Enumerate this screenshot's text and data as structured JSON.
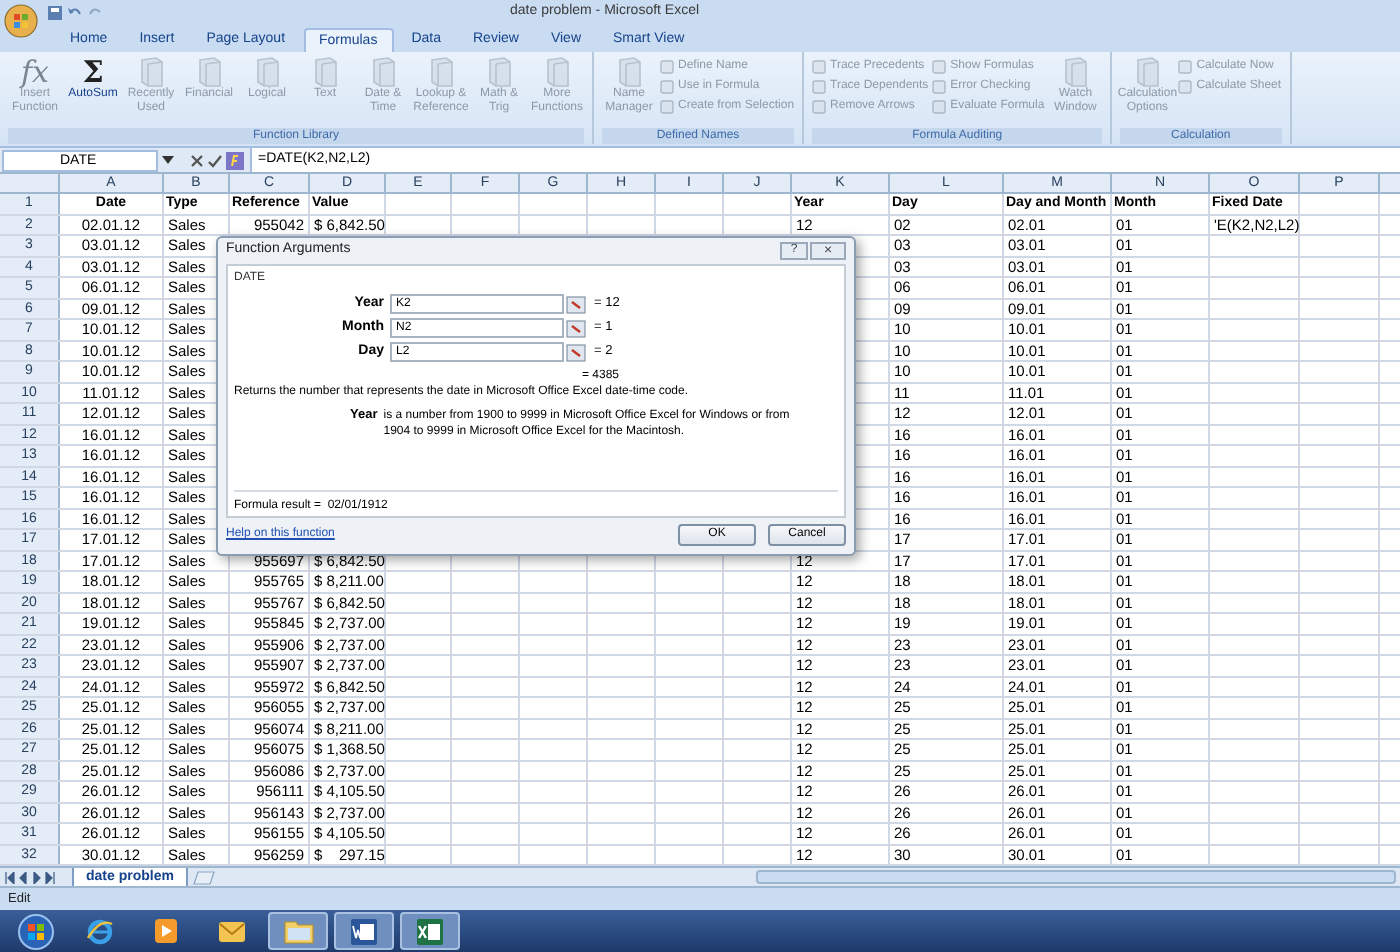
{
  "window": {
    "title": "date problem - Microsoft Excel"
  },
  "tabs": [
    {
      "label": "Home",
      "selected": false
    },
    {
      "label": "Insert",
      "selected": false
    },
    {
      "label": "Page Layout",
      "selected": false
    },
    {
      "label": "Formulas",
      "selected": true
    },
    {
      "label": "Data",
      "selected": false
    },
    {
      "label": "Review",
      "selected": false
    },
    {
      "label": "View",
      "selected": false
    },
    {
      "label": "Smart View",
      "selected": false
    }
  ],
  "ribbon": [
    {
      "label": "Function Library",
      "items": [
        {
          "kind": "large",
          "label": "Insert Function",
          "glyph": "fx",
          "disabled": true
        },
        {
          "kind": "large",
          "label": "AutoSum",
          "glyph": "Σ",
          "disabled": false
        },
        {
          "kind": "large",
          "label": "Recently Used",
          "disabled": true
        },
        {
          "kind": "large",
          "label": "Financial",
          "disabled": true
        },
        {
          "kind": "large",
          "label": "Logical",
          "disabled": true
        },
        {
          "kind": "large",
          "label": "Text",
          "disabled": true
        },
        {
          "kind": "large",
          "label": "Date & Time",
          "disabled": true
        },
        {
          "kind": "large",
          "label": "Lookup & Reference",
          "disabled": true
        },
        {
          "kind": "large",
          "label": "Math & Trig",
          "disabled": true
        },
        {
          "kind": "large",
          "label": "More Functions",
          "disabled": true
        }
      ]
    },
    {
      "label": "Defined Names",
      "items": [
        {
          "kind": "large",
          "label": "Name Manager",
          "disabled": true
        },
        {
          "kind": "small",
          "label": "Define Name",
          "disabled": true
        },
        {
          "kind": "small",
          "label": "Use in Formula",
          "disabled": true
        },
        {
          "kind": "small",
          "label": "Create from Selection",
          "disabled": true
        }
      ]
    },
    {
      "label": "Formula Auditing",
      "items": [
        {
          "kind": "small",
          "label": "Trace Precedents",
          "disabled": true
        },
        {
          "kind": "small",
          "label": "Trace Dependents",
          "disabled": true
        },
        {
          "kind": "small",
          "label": "Remove Arrows",
          "disabled": true
        },
        {
          "kind": "small",
          "label": "Show Formulas",
          "disabled": true
        },
        {
          "kind": "small",
          "label": "Error Checking",
          "disabled": true
        },
        {
          "kind": "small",
          "label": "Evaluate Formula",
          "disabled": true
        },
        {
          "kind": "large",
          "label": "Watch Window",
          "disabled": true
        }
      ]
    },
    {
      "label": "Calculation",
      "items": [
        {
          "kind": "large",
          "label": "Calculation Options",
          "disabled": true
        },
        {
          "kind": "small",
          "label": "Calculate Now",
          "disabled": true
        },
        {
          "kind": "small",
          "label": "Calculate Sheet",
          "disabled": true
        }
      ]
    }
  ],
  "formula_bar": {
    "name_box": "DATE",
    "formula": "=DATE(K2,N2,L2)"
  },
  "columns": [
    "A",
    "B",
    "C",
    "D",
    "E",
    "F",
    "G",
    "H",
    "I",
    "J",
    "K",
    "L",
    "M",
    "N",
    "O",
    "P"
  ],
  "rows": [
    {
      "number": "1",
      "cells": {
        "A": "Date",
        "B": "Type",
        "C": "Reference",
        "D": "Value",
        "K": "Year",
        "L": "Day",
        "M": "Day and Month",
        "N": "Month",
        "O": "Fixed Date"
      }
    },
    {
      "number": "2",
      "cells": {
        "A": "02.01.12",
        "B": "Sales",
        "C": "955042",
        "D": "$ 6,842.50",
        "K": "12",
        "L": "02",
        "M": "02.01",
        "N": "01",
        "O": "'E(K2,N2,L2)"
      }
    },
    {
      "number": "3",
      "cells": {
        "A": "03.01.12",
        "B": "Sales",
        "L": "03",
        "M": "03.01",
        "N": "01"
      }
    },
    {
      "number": "4",
      "cells": {
        "A": "03.01.12",
        "B": "Sales",
        "L": "03",
        "M": "03.01",
        "N": "01"
      }
    },
    {
      "number": "5",
      "cells": {
        "A": "06.01.12",
        "B": "Sales",
        "L": "06",
        "M": "06.01",
        "N": "01"
      }
    },
    {
      "number": "6",
      "cells": {
        "A": "09.01.12",
        "B": "Sales",
        "L": "09",
        "M": "09.01",
        "N": "01"
      }
    },
    {
      "number": "7",
      "cells": {
        "A": "10.01.12",
        "B": "Sales",
        "L": "10",
        "M": "10.01",
        "N": "01"
      }
    },
    {
      "number": "8",
      "cells": {
        "A": "10.01.12",
        "B": "Sales",
        "L": "10",
        "M": "10.01",
        "N": "01"
      }
    },
    {
      "number": "9",
      "cells": {
        "A": "10.01.12",
        "B": "Sales",
        "L": "10",
        "M": "10.01",
        "N": "01"
      }
    },
    {
      "number": "10",
      "cells": {
        "A": "11.01.12",
        "B": "Sales",
        "L": "11",
        "M": "11.01",
        "N": "01"
      }
    },
    {
      "number": "11",
      "cells": {
        "A": "12.01.12",
        "B": "Sales",
        "L": "12",
        "M": "12.01",
        "N": "01"
      }
    },
    {
      "number": "12",
      "cells": {
        "A": "16.01.12",
        "B": "Sales",
        "L": "16",
        "M": "16.01",
        "N": "01"
      }
    },
    {
      "number": "13",
      "cells": {
        "A": "16.01.12",
        "B": "Sales",
        "L": "16",
        "M": "16.01",
        "N": "01"
      }
    },
    {
      "number": "14",
      "cells": {
        "A": "16.01.12",
        "B": "Sales",
        "L": "16",
        "M": "16.01",
        "N": "01"
      }
    },
    {
      "number": "15",
      "cells": {
        "A": "16.01.12",
        "B": "Sales",
        "L": "16",
        "M": "16.01",
        "N": "01"
      }
    },
    {
      "number": "16",
      "cells": {
        "A": "16.01.12",
        "B": "Sales",
        "L": "16",
        "M": "16.01",
        "N": "01"
      }
    },
    {
      "number": "17",
      "cells": {
        "A": "17.01.12",
        "B": "Sales",
        "L": "17",
        "M": "17.01",
        "N": "01"
      }
    },
    {
      "number": "18",
      "cells": {
        "A": "17.01.12",
        "B": "Sales",
        "C": "955697",
        "D": "$ 6,842.50",
        "K": "12",
        "L": "17",
        "M": "17.01",
        "N": "01"
      }
    },
    {
      "number": "19",
      "cells": {
        "A": "18.01.12",
        "B": "Sales",
        "C": "955765",
        "D": "$ 8,211.00",
        "K": "12",
        "L": "18",
        "M": "18.01",
        "N": "01"
      }
    },
    {
      "number": "20",
      "cells": {
        "A": "18.01.12",
        "B": "Sales",
        "C": "955767",
        "D": "$ 6,842.50",
        "K": "12",
        "L": "18",
        "M": "18.01",
        "N": "01"
      }
    },
    {
      "number": "21",
      "cells": {
        "A": "19.01.12",
        "B": "Sales",
        "C": "955845",
        "D": "$ 2,737.00",
        "K": "12",
        "L": "19",
        "M": "19.01",
        "N": "01"
      }
    },
    {
      "number": "22",
      "cells": {
        "A": "23.01.12",
        "B": "Sales",
        "C": "955906",
        "D": "$ 2,737.00",
        "K": "12",
        "L": "23",
        "M": "23.01",
        "N": "01"
      }
    },
    {
      "number": "23",
      "cells": {
        "A": "23.01.12",
        "B": "Sales",
        "C": "955907",
        "D": "$ 2,737.00",
        "K": "12",
        "L": "23",
        "M": "23.01",
        "N": "01"
      }
    },
    {
      "number": "24",
      "cells": {
        "A": "24.01.12",
        "B": "Sales",
        "C": "955972",
        "D": "$ 6,842.50",
        "K": "12",
        "L": "24",
        "M": "24.01",
        "N": "01"
      }
    },
    {
      "number": "25",
      "cells": {
        "A": "25.01.12",
        "B": "Sales",
        "C": "956055",
        "D": "$ 2,737.00",
        "K": "12",
        "L": "25",
        "M": "25.01",
        "N": "01"
      }
    },
    {
      "number": "26",
      "cells": {
        "A": "25.01.12",
        "B": "Sales",
        "C": "956074",
        "D": "$ 8,211.00",
        "K": "12",
        "L": "25",
        "M": "25.01",
        "N": "01"
      }
    },
    {
      "number": "27",
      "cells": {
        "A": "25.01.12",
        "B": "Sales",
        "C": "956075",
        "D": "$ 1,368.50",
        "K": "12",
        "L": "25",
        "M": "25.01",
        "N": "01"
      }
    },
    {
      "number": "28",
      "cells": {
        "A": "25.01.12",
        "B": "Sales",
        "C": "956086",
        "D": "$ 2,737.00",
        "K": "12",
        "L": "25",
        "M": "25.01",
        "N": "01"
      }
    },
    {
      "number": "29",
      "cells": {
        "A": "26.01.12",
        "B": "Sales",
        "C": "956111",
        "D": "$ 4,105.50",
        "K": "12",
        "L": "26",
        "M": "26.01",
        "N": "01"
      }
    },
    {
      "number": "30",
      "cells": {
        "A": "26.01.12",
        "B": "Sales",
        "C": "956143",
        "D": "$ 2,737.00",
        "K": "12",
        "L": "26",
        "M": "26.01",
        "N": "01"
      }
    },
    {
      "number": "31",
      "cells": {
        "A": "26.01.12",
        "B": "Sales",
        "C": "956155",
        "D": "$ 4,105.50",
        "K": "12",
        "L": "26",
        "M": "26.01",
        "N": "01"
      }
    },
    {
      "number": "32",
      "cells": {
        "A": "30.01.12",
        "B": "Sales",
        "C": "956259",
        "D": "$    297.15",
        "K": "12",
        "L": "30",
        "M": "30.01",
        "N": "01"
      }
    }
  ],
  "dialog": {
    "title": "Function Arguments",
    "help_button": "?",
    "close_button": "×",
    "function": "DATE",
    "arguments": [
      {
        "label": "Year",
        "value": "K2",
        "result": "= 12"
      },
      {
        "label": "Month",
        "value": "N2",
        "result": "= 1"
      },
      {
        "label": "Day",
        "value": "L2",
        "result": "= 2"
      }
    ],
    "result": "= 4385",
    "description": "Returns the number that represents the date in Microsoft Office Excel date-time code.",
    "argument_name": "Year",
    "argument_help": "is a number from 1900 to 9999 in Microsoft Office Excel for Windows or from 1904 to 9999 in Microsoft Office Excel for the Macintosh.",
    "formula_result": "Formula result =  02/01/1912",
    "help_link": "Help on this function",
    "buttons": [
      "OK",
      "Cancel"
    ]
  },
  "sheet_tabs": [
    {
      "label": "date problem",
      "selected": true
    }
  ],
  "status_bar": {
    "mode": "Edit"
  },
  "taskbar": [
    {
      "kind": "start",
      "running": false
    },
    {
      "kind": "browser",
      "running": false
    },
    {
      "kind": "media",
      "running": false
    },
    {
      "kind": "mail",
      "running": false
    },
    {
      "kind": "folder",
      "running": true
    },
    {
      "kind": "word",
      "running": true
    },
    {
      "kind": "excel",
      "running": true
    }
  ]
}
